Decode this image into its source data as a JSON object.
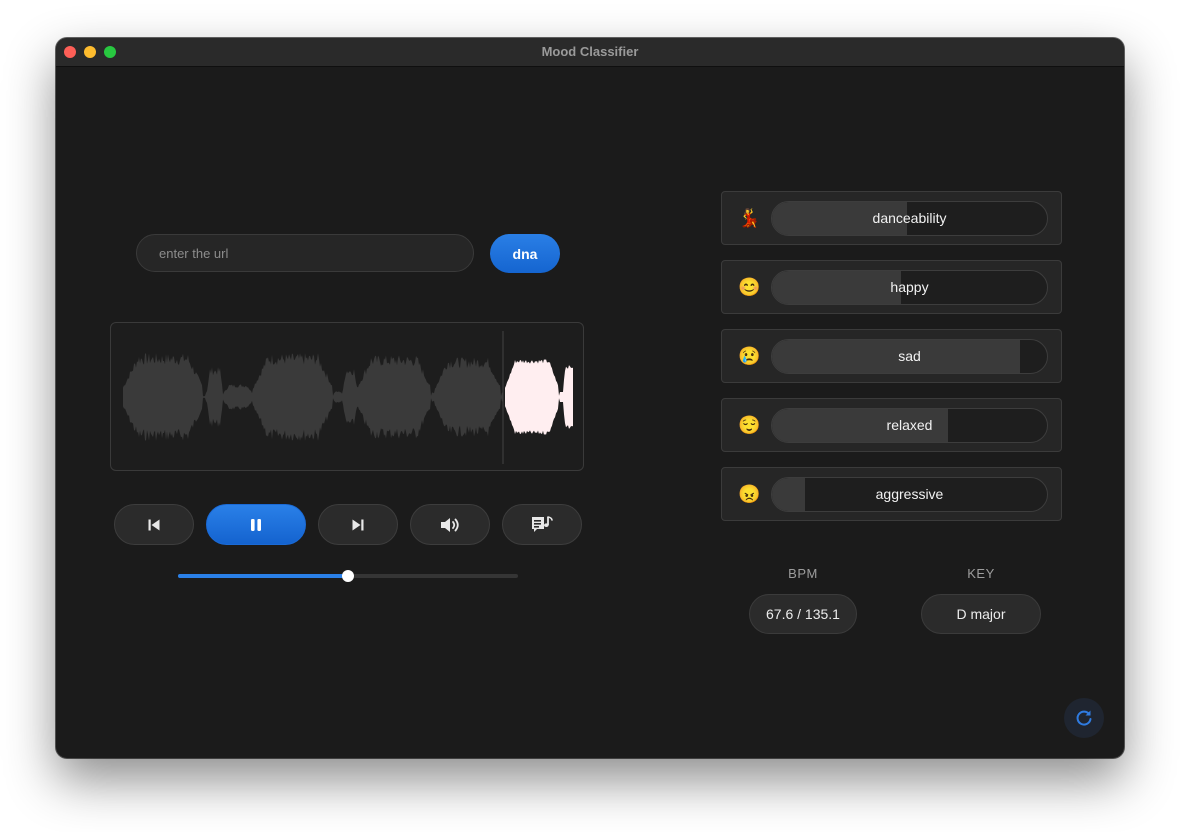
{
  "window": {
    "title": "Mood Classifier"
  },
  "search": {
    "placeholder": "enter the url",
    "value": "",
    "button_label": "dna"
  },
  "player": {
    "progress": 0.5,
    "is_playing": true
  },
  "moods": [
    {
      "name": "danceability",
      "emoji": "💃",
      "value": 0.49
    },
    {
      "name": "happy",
      "emoji": "😊",
      "value": 0.47
    },
    {
      "name": "sad",
      "emoji": "😢",
      "value": 0.9
    },
    {
      "name": "relaxed",
      "emoji": "😌",
      "value": 0.64
    },
    {
      "name": "aggressive",
      "emoji": "😠",
      "value": 0.12
    }
  ],
  "stats": {
    "bpm_label": "BPM",
    "bpm_value": "67.6 / 135.1",
    "key_label": "KEY",
    "key_value": "D major"
  },
  "colors": {
    "accent": "#1f73e0",
    "waveform": "#3a3a3a",
    "waveform_highlight": "#ffeef0"
  }
}
